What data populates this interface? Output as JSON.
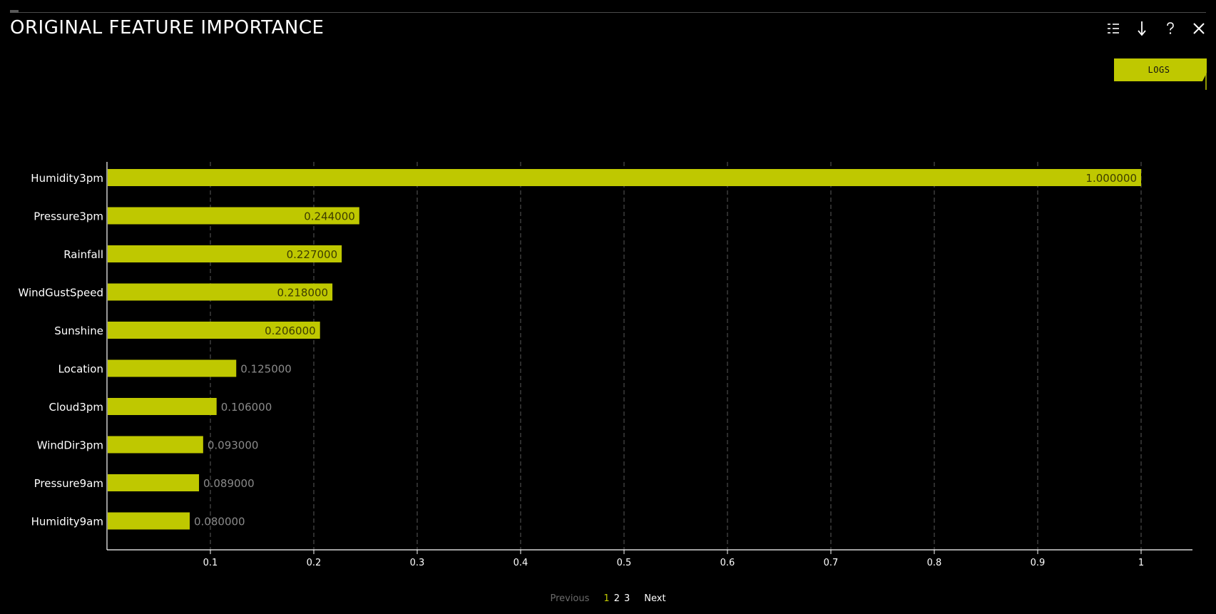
{
  "panel": {
    "title": "ORIGINAL FEATURE IMPORTANCE",
    "logs_label": "LOGS",
    "accent_color": "#bfc800"
  },
  "toolbar": {
    "icons": [
      "list-icon",
      "download-icon",
      "help-icon",
      "close-icon"
    ]
  },
  "chart_data": {
    "type": "bar",
    "orientation": "horizontal",
    "categories": [
      "Humidity3pm",
      "Pressure3pm",
      "Rainfall",
      "WindGustSpeed",
      "Sunshine",
      "Location",
      "Cloud3pm",
      "WindDir3pm",
      "Pressure9am",
      "Humidity9am"
    ],
    "values": [
      1.0,
      0.244,
      0.227,
      0.218,
      0.206,
      0.125,
      0.106,
      0.093,
      0.089,
      0.08
    ],
    "value_labels": [
      "1.000000",
      "0.244000",
      "0.227000",
      "0.218000",
      "0.206000",
      "0.125000",
      "0.106000",
      "0.093000",
      "0.089000",
      "0.080000"
    ],
    "x_ticks": [
      "0.1",
      "0.2",
      "0.3",
      "0.4",
      "0.5",
      "0.6",
      "0.7",
      "0.8",
      "0.9",
      "1"
    ],
    "xlim": [
      0,
      1.05
    ],
    "grid": "vertical dashed",
    "bar_color": "#bfc800",
    "title": "",
    "xlabel": "",
    "ylabel": ""
  },
  "pagination": {
    "previous_label": "Previous",
    "pages": [
      "1",
      "2",
      "3"
    ],
    "current_page": "1",
    "next_label": "Next"
  }
}
